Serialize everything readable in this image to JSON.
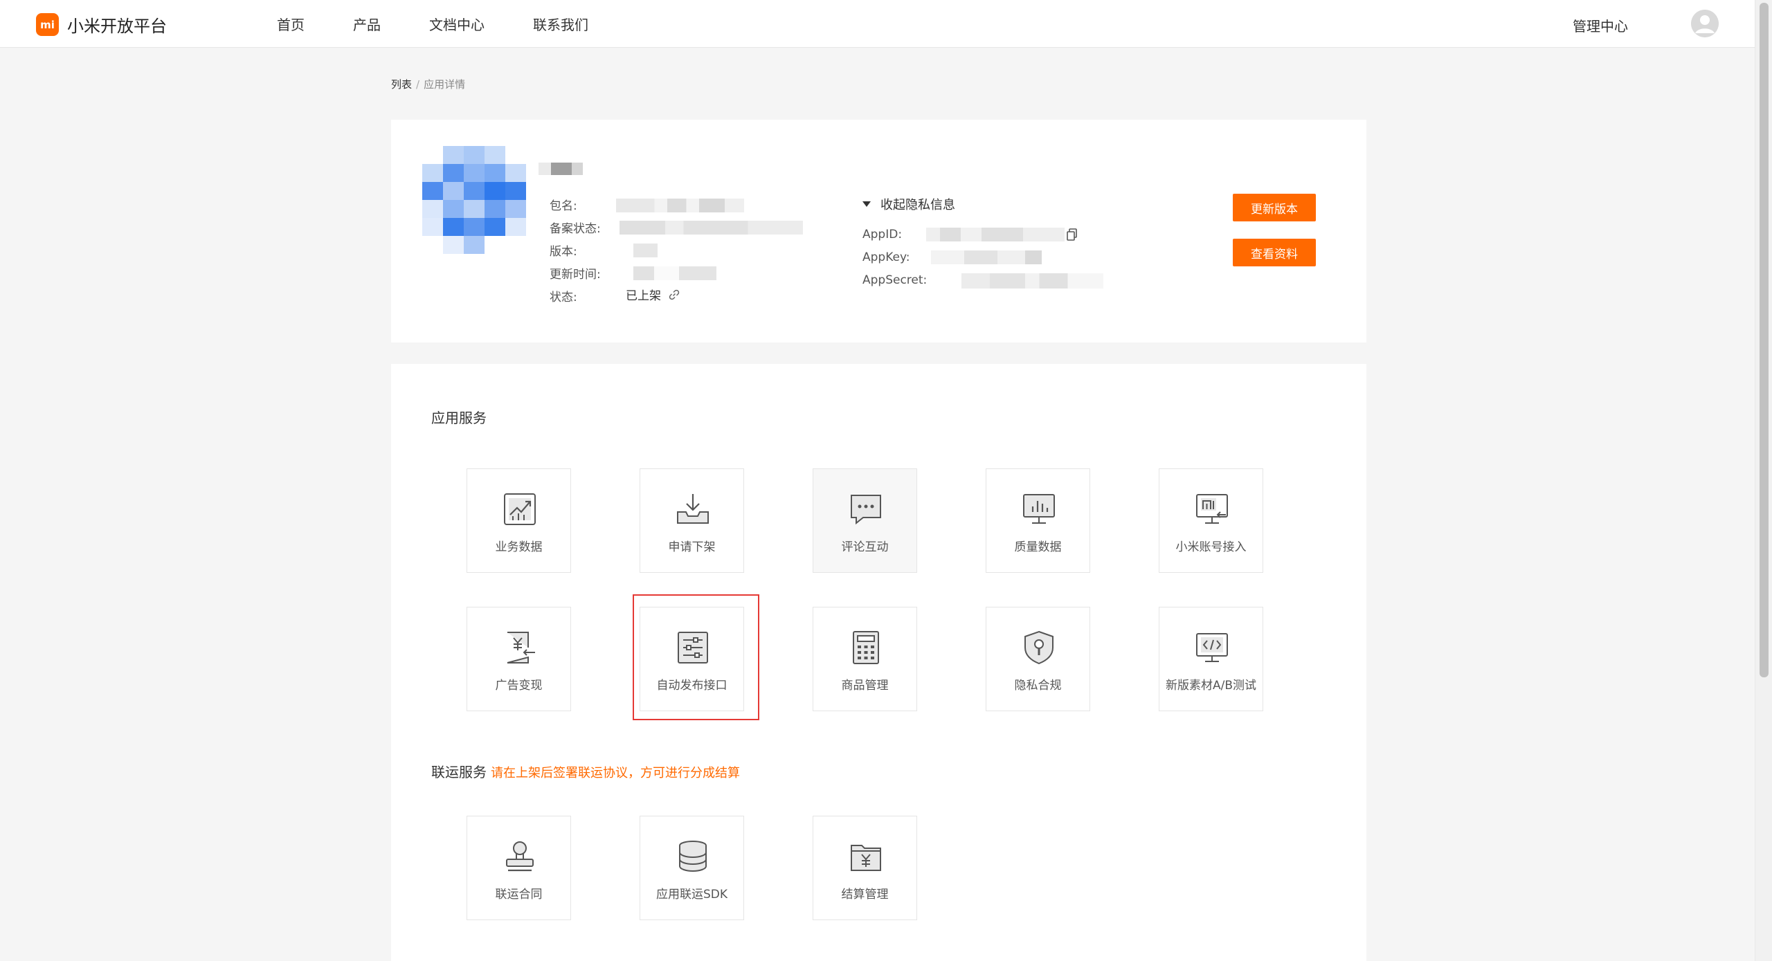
{
  "header": {
    "logo_mark": "mi",
    "logo_text": "小米开放平台",
    "nav": [
      "首页",
      "产品",
      "文档中心",
      "联系我们"
    ],
    "management": "管理中心"
  },
  "breadcrumb": {
    "items": [
      "列表",
      "应用详情"
    ],
    "separator": "/"
  },
  "app_info": {
    "labels": [
      "包名:",
      "备案状态:",
      "版本:",
      "更新时间:",
      "状态:"
    ],
    "status_value": "已上架",
    "privacy_toggle": "收起隐私信息",
    "privacy_labels": [
      "AppID:",
      "AppKey:",
      "AppSecret:"
    ],
    "buttons": {
      "update": "更新版本",
      "view": "查看资料"
    }
  },
  "app_services": {
    "title": "应用服务",
    "tiles": [
      {
        "label": "业务数据",
        "icon": "chart-up-icon"
      },
      {
        "label": "申请下架",
        "icon": "download-tray-icon"
      },
      {
        "label": "评论互动",
        "icon": "comment-icon"
      },
      {
        "label": "质量数据",
        "icon": "monitor-chart-icon"
      },
      {
        "label": "小米账号接入",
        "icon": "mi-account-icon"
      },
      {
        "label": "广告变现",
        "icon": "yuan-document-icon"
      },
      {
        "label": "自动发布接口",
        "icon": "sliders-icon"
      },
      {
        "label": "商品管理",
        "icon": "calculator-icon"
      },
      {
        "label": "隐私合规",
        "icon": "shield-lock-icon"
      },
      {
        "label": "新版素材A/B测试",
        "icon": "code-monitor-icon"
      }
    ]
  },
  "joint_services": {
    "title": "联运服务",
    "note": "请在上架后签署联运协议，方可进行分成结算",
    "tiles": [
      {
        "label": "联运合同",
        "icon": "stamp-icon"
      },
      {
        "label": "应用联运SDK",
        "icon": "database-icon"
      },
      {
        "label": "结算管理",
        "icon": "yuan-folder-icon"
      }
    ]
  },
  "colors": {
    "accent": "#ff6900",
    "highlight_border": "#e53935"
  }
}
